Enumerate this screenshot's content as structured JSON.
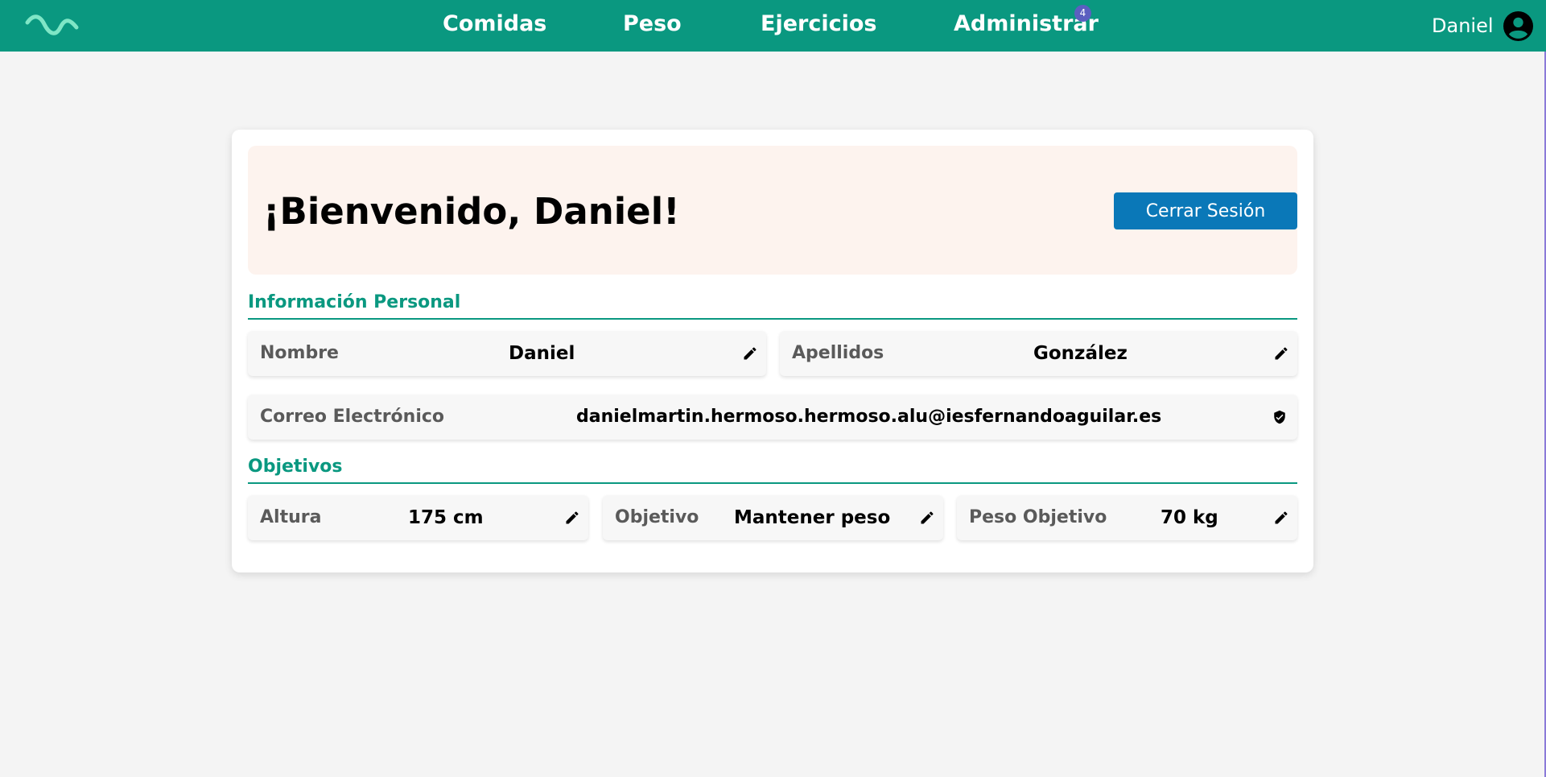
{
  "nav": {
    "links": [
      "Comidas",
      "Peso",
      "Ejercicios",
      "Administrar"
    ],
    "admin_badge": "4",
    "user_name": "Daniel",
    "logo_icon": "wave-logo-icon",
    "avatar_icon": "account-circle-icon",
    "bar_color": "#0a9880"
  },
  "welcome": {
    "title": "¡Bienvenido, Daniel!",
    "logout_label": "Cerrar Sesión"
  },
  "personal": {
    "section_title": "Información Personal",
    "fields": [
      {
        "label": "Nombre",
        "value": "Daniel",
        "icon": "pencil-icon"
      },
      {
        "label": "Apellidos",
        "value": "González",
        "icon": "pencil-icon"
      },
      {
        "label": "Correo Electrónico",
        "value": "danielmartin.hermoso.hermoso.alu@iesfernandoaguilar.es",
        "icon": "verified-shield-icon"
      }
    ]
  },
  "goals": {
    "section_title": "Objetivos",
    "fields": [
      {
        "label": "Altura",
        "value": "175 cm",
        "icon": "pencil-icon"
      },
      {
        "label": "Objetivo",
        "value": "Mantener peso",
        "icon": "pencil-icon"
      },
      {
        "label": "Peso Objetivo",
        "value": "70 kg",
        "icon": "pencil-icon"
      }
    ]
  },
  "colors": {
    "accent": "#0a9880",
    "button": "#0a78b8",
    "badge": "#5b5fc0"
  }
}
